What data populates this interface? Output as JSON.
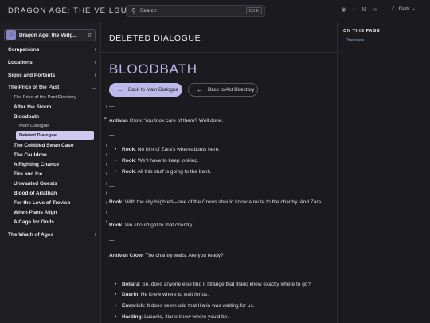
{
  "header": {
    "site_title": "DRAGON AGE: THE VEILGUARD",
    "search_placeholder": "Search",
    "search_shortcut": "Ctrl K",
    "theme_label": "Dark"
  },
  "sidebar": {
    "project_name": "Dragon Age: the Veilg...",
    "items": [
      {
        "label": "Companions",
        "chevron": "›"
      },
      {
        "label": "Locations",
        "chevron": "›"
      },
      {
        "label": "Signs and Portents",
        "chevron": "›"
      },
      {
        "label": "The Price of the Past",
        "chevron": "⌄"
      },
      {
        "label": "The Price of the Past Directory"
      },
      {
        "label": "After the Storm",
        "chevron": "›"
      },
      {
        "label": "Bloodbath",
        "chevron": "⌄"
      },
      {
        "label": "Main Dialogue"
      },
      {
        "label": "Deleted Dialogue"
      },
      {
        "label": "The Cobbled Swan Case",
        "chevron": "›"
      },
      {
        "label": "The Cauldron",
        "chevron": "›"
      },
      {
        "label": "A Fighting Chance",
        "chevron": "›"
      },
      {
        "label": "Fire and Ice",
        "chevron": "›"
      },
      {
        "label": "Unwanted Guests",
        "chevron": "›"
      },
      {
        "label": "Blood of Arlathan",
        "chevron": "›"
      },
      {
        "label": "For the Love of Treviso",
        "chevron": "›"
      },
      {
        "label": "When Plans Align",
        "chevron": "›"
      },
      {
        "label": "A Cage for Gods",
        "chevron": "›"
      },
      {
        "label": "The Wrath of Ages",
        "chevron": "›"
      }
    ]
  },
  "main": {
    "section_header": "DELETED DIALOGUE",
    "page_title": "BLOODBATH",
    "back_main": "Back to Main Dialogue",
    "back_act": "Back to Act Directory",
    "sep": "—",
    "l1_name": "Antivan",
    "l1_text": " Crow: You took care of them? Well done.",
    "b1": [
      {
        "name": "Rook",
        "text": ": No hint of Zara's whereabouts here."
      },
      {
        "name": "Rook",
        "text": ": We'll have to keep looking."
      },
      {
        "name": "Rook",
        "text": ": All this stuff is going to the bank."
      }
    ],
    "l2_name": "Rook",
    "l2_text": ": With the city blighted—one of the Crows should know a route to the chantry. And Zara.",
    "l3_name": "Rook",
    "l3_text": ": We should get to that chantry.",
    "l4_name": "Antivan Crow",
    "l4_text": ": The chantry waits. Are you ready?",
    "b2": [
      {
        "name": "Bellara",
        "text": ": So, does anyone else find it strange that Illario knew exactly where to go?"
      },
      {
        "name": "Davrin",
        "text": ": He knew where to wait for us."
      },
      {
        "name": "Emmrich",
        "text": ": It does seem odd that Illario was waiting for us."
      },
      {
        "name": "Harding",
        "text": ": Lucanis, Illario knew where you'd be."
      }
    ]
  },
  "rail": {
    "title": "ON THIS PAGE",
    "overview": "Overview"
  }
}
